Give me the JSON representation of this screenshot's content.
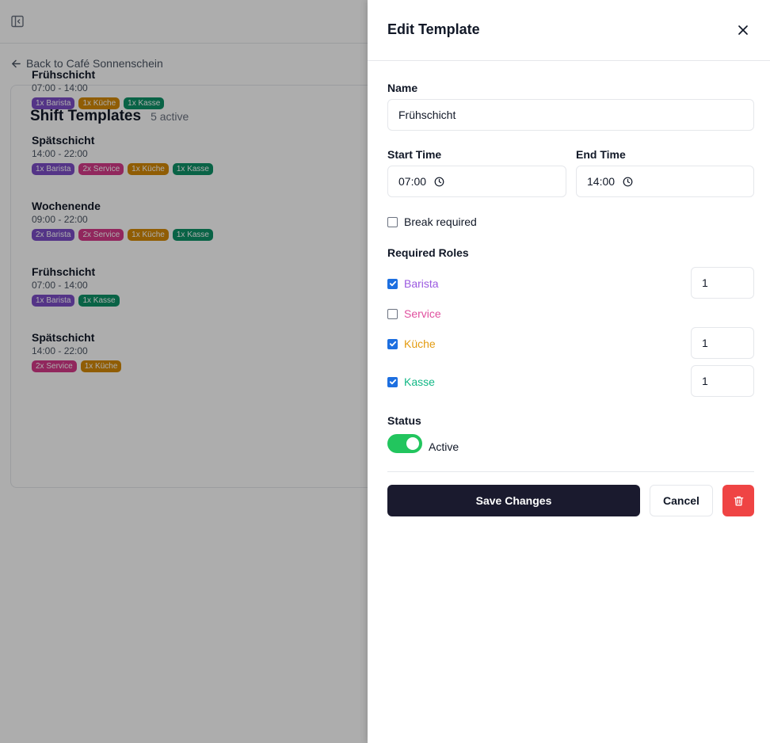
{
  "background": {
    "back_link": "Back to Café Sonnenschein",
    "card_title": "Shift Templates",
    "card_subtitle": "5 active",
    "templates": [
      {
        "name": "Frühschicht",
        "time": "07:00 - 14:00",
        "tags": [
          {
            "label": "1x Barista",
            "color": "#7c4dc8"
          },
          {
            "label": "1x Küche",
            "color": "#d48a07"
          },
          {
            "label": "1x Kasse",
            "color": "#0e9367"
          }
        ]
      },
      {
        "name": "Spätschicht",
        "time": "14:00 - 22:00",
        "tags": [
          {
            "label": "1x Barista",
            "color": "#7c4dc8"
          },
          {
            "label": "2x Service",
            "color": "#d63a8a"
          },
          {
            "label": "1x Küche",
            "color": "#d48a07"
          },
          {
            "label": "1x Kasse",
            "color": "#0e9367"
          }
        ]
      },
      {
        "name": "Wochenende",
        "time": "09:00 - 22:00",
        "tags": [
          {
            "label": "2x Barista",
            "color": "#7c4dc8"
          },
          {
            "label": "2x Service",
            "color": "#d63a8a"
          },
          {
            "label": "1x Küche",
            "color": "#d48a07"
          },
          {
            "label": "1x Kasse",
            "color": "#0e9367"
          }
        ]
      },
      {
        "name": "Frühschicht",
        "time": "07:00 - 14:00",
        "tags": [
          {
            "label": "1x Barista",
            "color": "#7c4dc8"
          },
          {
            "label": "1x Kasse",
            "color": "#0e9367"
          }
        ]
      },
      {
        "name": "Spätschicht",
        "time": "14:00 - 22:00",
        "tags": [
          {
            "label": "2x Service",
            "color": "#d63a8a"
          },
          {
            "label": "1x Küche",
            "color": "#d48a07"
          }
        ]
      }
    ]
  },
  "drawer": {
    "title": "Edit Template",
    "name_label": "Name",
    "name_value": "Frühschicht",
    "start_label": "Start Time",
    "start_value": "07:00",
    "end_label": "End Time",
    "end_value": "14:00",
    "break_label": "Break required",
    "break_checked": false,
    "roles_label": "Required Roles",
    "roles": {
      "barista": {
        "label": "Barista",
        "checked": true,
        "qty": "1",
        "color": "#9b59e0"
      },
      "service": {
        "label": "Service",
        "checked": false,
        "color": "#e0509f"
      },
      "kueche": {
        "label": "Küche",
        "checked": true,
        "qty": "1",
        "color": "#e39b0f"
      },
      "kasse": {
        "label": "Kasse",
        "checked": true,
        "qty": "1",
        "color": "#12b886"
      }
    },
    "status_label": "Status",
    "status_value": "Active",
    "status_active": true,
    "save_label": "Save Changes",
    "cancel_label": "Cancel"
  },
  "icons": {
    "sidebar_toggle": "sidebar-toggle-icon",
    "back": "arrow-left-icon",
    "close": "close-icon",
    "clock": "clock-icon",
    "checkmark": "check-icon",
    "delete": "trash-icon"
  }
}
